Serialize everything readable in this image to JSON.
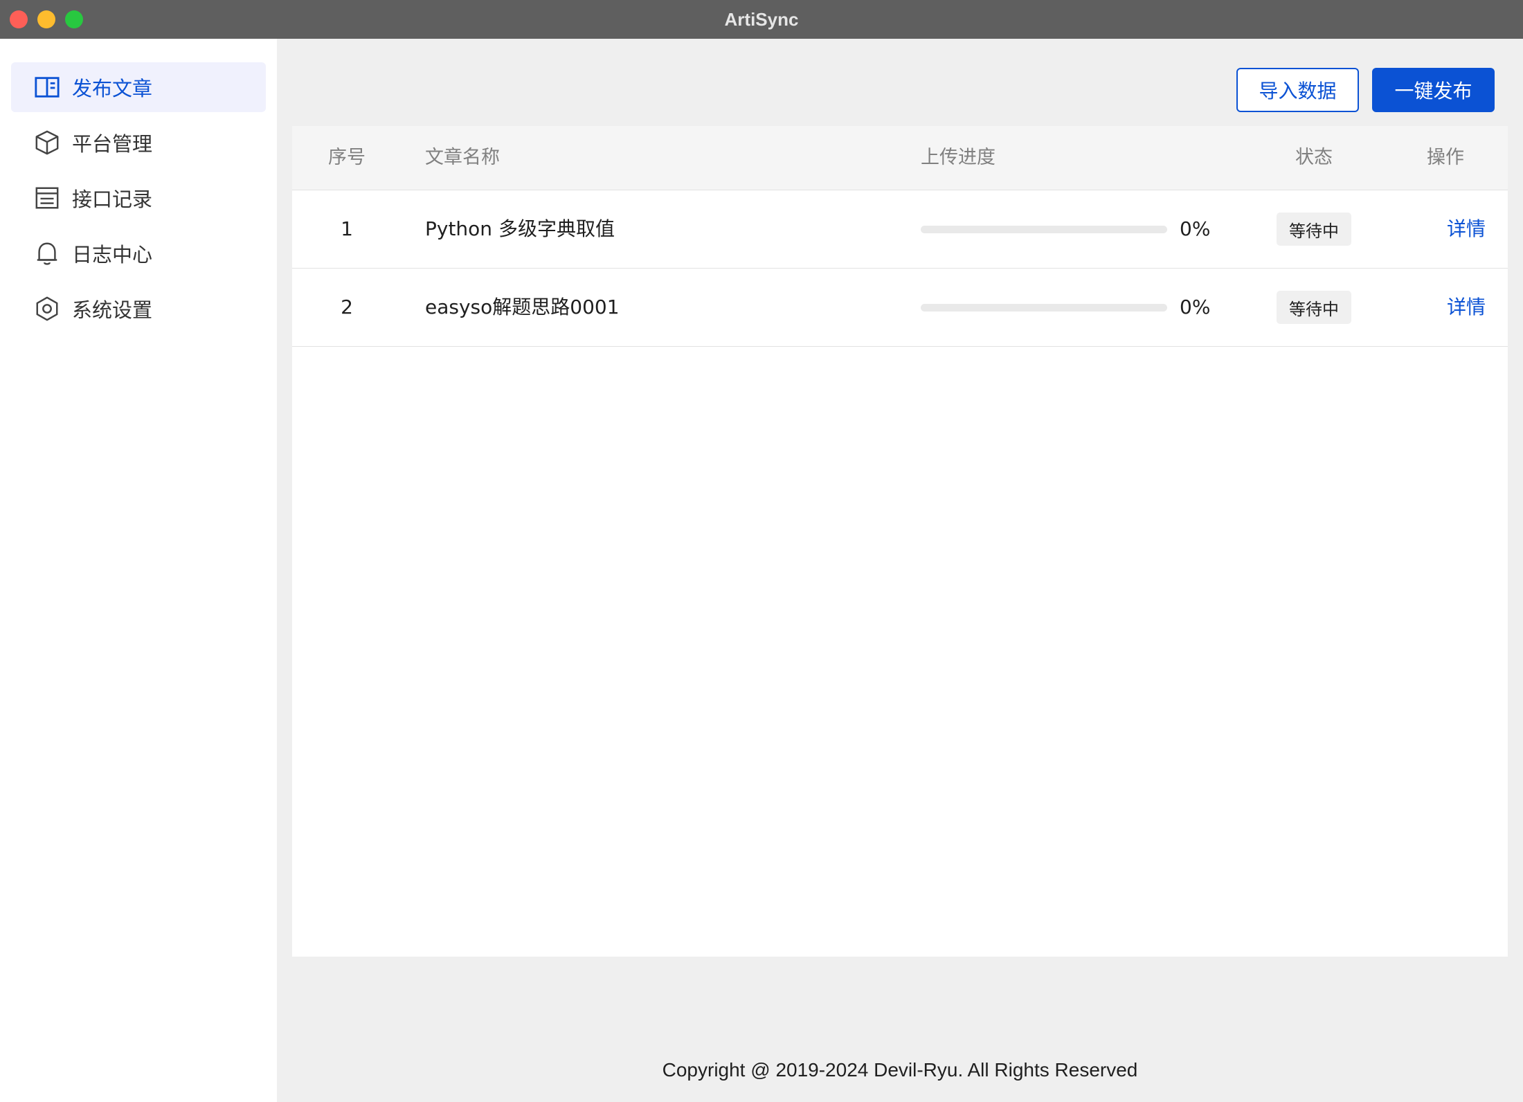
{
  "window": {
    "title": "ArtiSync"
  },
  "sidebar": {
    "items": [
      {
        "label": "发布文章",
        "icon": "book-open-icon",
        "active": true
      },
      {
        "label": "平台管理",
        "icon": "cube-icon",
        "active": false
      },
      {
        "label": "接口记录",
        "icon": "list-document-icon",
        "active": false
      },
      {
        "label": "日志中心",
        "icon": "bell-icon",
        "active": false
      },
      {
        "label": "系统设置",
        "icon": "settings-hexagon-icon",
        "active": false
      }
    ]
  },
  "toolbar": {
    "import_label": "导入数据",
    "publish_label": "一键发布"
  },
  "table": {
    "headers": {
      "index": "序号",
      "name": "文章名称",
      "progress": "上传进度",
      "status": "状态",
      "action": "操作"
    },
    "rows": [
      {
        "index": "1",
        "name": "Python 多级字典取值",
        "progress": 0,
        "progress_text": "0%",
        "status": "等待中",
        "action": "详情"
      },
      {
        "index": "2",
        "name": "easyso解题思路0001",
        "progress": 0,
        "progress_text": "0%",
        "status": "等待中",
        "action": "详情"
      }
    ]
  },
  "footer": {
    "copyright": "Copyright @ 2019-2024 Devil-Ryu. All Rights Reserved"
  },
  "colors": {
    "accent": "#0b52d4",
    "sidebar_active_bg": "#f0f1fd",
    "titlebar": "#5f5f5f"
  }
}
